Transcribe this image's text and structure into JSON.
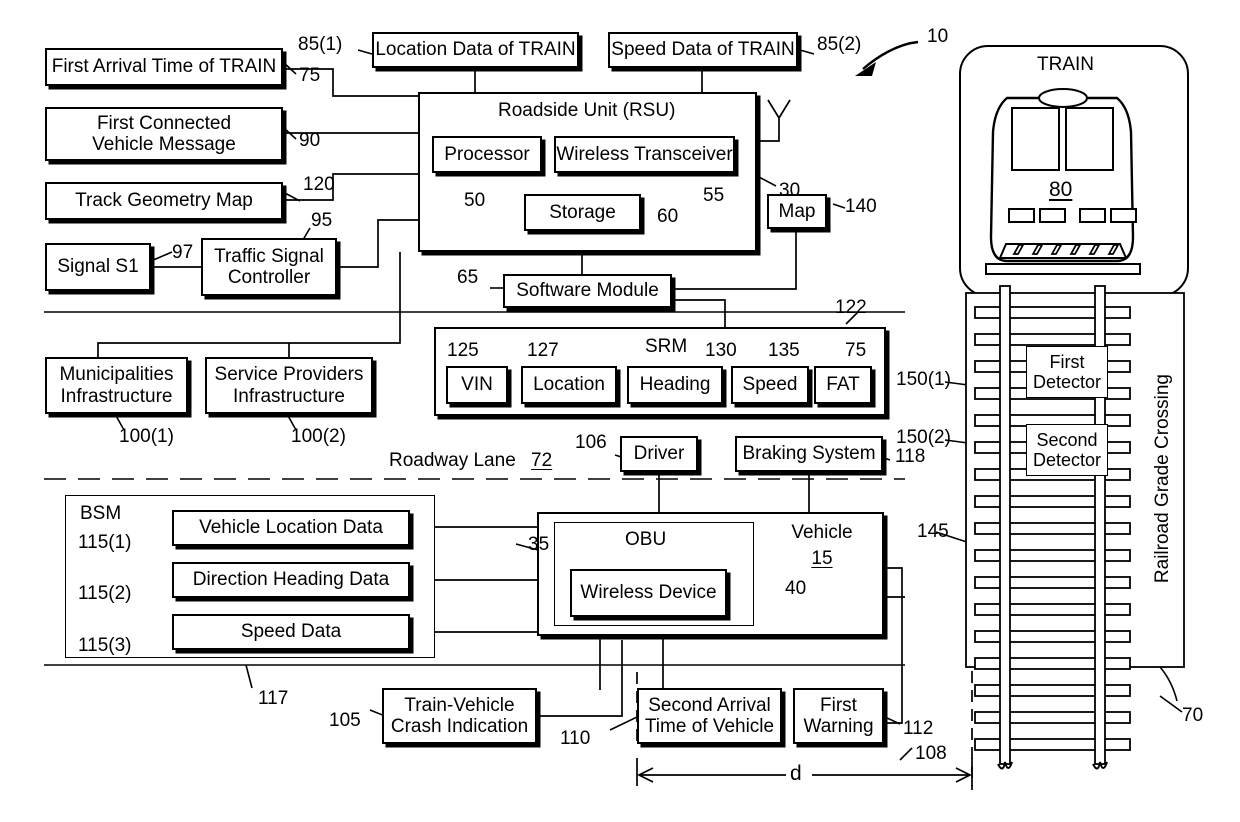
{
  "figure": {
    "ref_number": "10",
    "distance_label": "d"
  },
  "left_column": {
    "first_arrival_time": {
      "label": "First Arrival Time of TRAIN",
      "ref": "75"
    },
    "first_connected_vehicle_message": {
      "label": "First Connected\nVehicle Message",
      "line1": "First Connected",
      "line2": "Vehicle Message",
      "ref": "90"
    },
    "track_geometry_map": {
      "label": "Track Geometry Map",
      "ref": "120"
    },
    "signal_s1": {
      "label": "Signal S1"
    },
    "traffic_signal_controller": {
      "line1": "Traffic Signal",
      "line2": "Controller",
      "ref": "95",
      "link_ref": "97"
    }
  },
  "top_inputs": {
    "location_data": {
      "label": "Location Data of TRAIN",
      "ref": "85(1)"
    },
    "speed_data": {
      "label": "Speed Data of TRAIN",
      "ref": "85(2)"
    }
  },
  "rsu": {
    "title": "Roadside Unit (RSU)",
    "ref": "30",
    "processor": {
      "label": "Processor",
      "ref": "50"
    },
    "wireless_transceiver": {
      "label": "Wireless Transceiver",
      "ref": "55"
    },
    "storage": {
      "label": "Storage",
      "ref": "60"
    },
    "software_module": {
      "label": "Software Module",
      "ref": "65"
    },
    "map": {
      "label": "Map",
      "ref": "140"
    }
  },
  "infrastructure": {
    "municipalities": {
      "line1": "Municipalities",
      "line2": "Infrastructure",
      "ref": "100(1)"
    },
    "service_providers": {
      "line1": "Service Providers",
      "line2": "Infrastructure",
      "ref": "100(2)"
    }
  },
  "srm": {
    "title": "SRM",
    "ref": "122",
    "fields": [
      {
        "label": "VIN",
        "ref": "125"
      },
      {
        "label": "Location",
        "ref": "127"
      },
      {
        "label": "Heading",
        "ref": "130"
      },
      {
        "label": "Speed",
        "ref": "135"
      },
      {
        "label": "FAT",
        "ref": "75"
      }
    ]
  },
  "roadway": {
    "label": "Roadway Lane",
    "ref": "72"
  },
  "vehicle_side": {
    "driver": {
      "label": "Driver",
      "ref": "106"
    },
    "braking_system": {
      "label": "Braking System",
      "ref": "118"
    },
    "vehicle": {
      "label": "Vehicle",
      "ref": "15",
      "box_ref": "35"
    },
    "obu": {
      "label": "OBU"
    },
    "wireless_device": {
      "label": "Wireless Device",
      "ref": "40"
    }
  },
  "bsm": {
    "title": "BSM",
    "ref": "117",
    "items": [
      {
        "label": "Vehicle Location Data",
        "ref": "115(1)"
      },
      {
        "label": "Direction Heading Data",
        "ref": "115(2)"
      },
      {
        "label": "Speed Data",
        "ref": "115(3)"
      }
    ]
  },
  "outputs": {
    "crash_indication": {
      "line1": "Train-Vehicle",
      "line2": "Crash Indication",
      "ref": "105"
    },
    "second_arrival_time": {
      "line1": "Second Arrival",
      "line2": "Time of Vehicle",
      "ref": "110"
    },
    "first_warning": {
      "line1": "First",
      "line2": "Warning",
      "ref": "112"
    },
    "distance": {
      "ref": "108"
    }
  },
  "railroad": {
    "train": {
      "title": "TRAIN",
      "ref": "80"
    },
    "crossing_label": "Railroad Grade Crossing",
    "crossing_ref": "70",
    "track_ref": "145",
    "detectors": [
      {
        "line1": "First",
        "line2": "Detector",
        "ref": "150(1)"
      },
      {
        "line1": "Second",
        "line2": "Detector",
        "ref": "150(2)"
      }
    ]
  }
}
